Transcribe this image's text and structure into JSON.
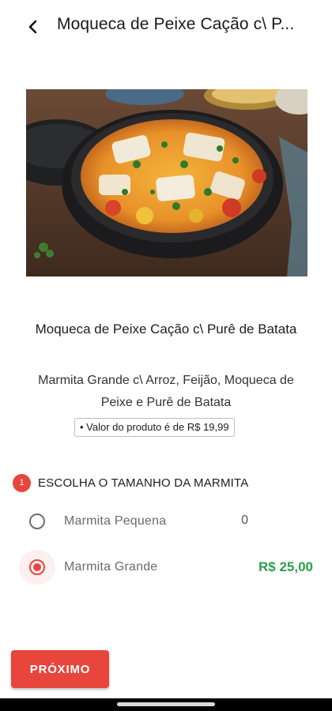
{
  "header": {
    "title": "Moqueca de Peixe Cação c\\ P..."
  },
  "product": {
    "image_alt": "moqueca-dish-photo",
    "title": "Moqueca de Peixe Cação c\\ Purê de Batata",
    "description": "Marmita Grande c\\ Arroz, Feijão, Moqueca de Peixe e Purê de Batata",
    "price_note": "• Valor do produto é de R$ 19,99"
  },
  "section": {
    "number": "1",
    "title": "ESCOLHA O TAMANHO DA MARMITA",
    "options": [
      {
        "label": "Marmita Pequena",
        "price": "0",
        "selected": false
      },
      {
        "label": "Marmita Grande",
        "price": "R$ 25,00",
        "selected": true
      }
    ]
  },
  "actions": {
    "next_label": "PRÓXIMO"
  },
  "colors": {
    "accent": "#e8453c",
    "price_green": "#2e9f4e"
  }
}
